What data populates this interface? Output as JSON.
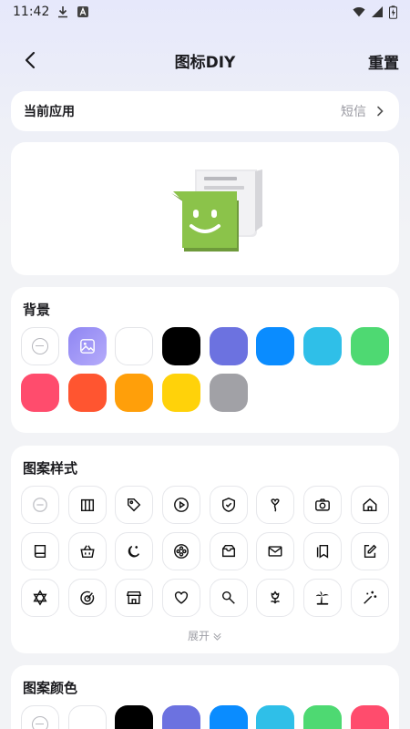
{
  "status_bar": {
    "time": "11:42"
  },
  "header": {
    "title": "图标DIY",
    "reset_label": "重置"
  },
  "current_app": {
    "label": "当前应用",
    "value": "短信"
  },
  "background": {
    "title": "背景",
    "colors": [
      "#ffffff",
      "#000000",
      "#6c72e0",
      "#0a8cff",
      "#2fbfe8",
      "#4ed972",
      "#ff4c6d",
      "#ff5530",
      "#ff9f0a",
      "#ffd20a",
      "#a1a1a6"
    ],
    "image_gradient": [
      "#8f86f3",
      "#b5abfa"
    ]
  },
  "pattern_style": {
    "title": "图案样式",
    "icons": [
      "none-icon",
      "books-icon",
      "tag-icon",
      "play-circle-icon",
      "shield-check-icon",
      "balloon-icon",
      "camera-icon",
      "home-icon",
      "book-icon",
      "basket-icon",
      "moon-stars-icon",
      "film-reel-icon",
      "tray-icon",
      "mail-icon",
      "bookmarks-icon",
      "edit-icon",
      "star-of-david-icon",
      "target-icon",
      "store-icon",
      "heart-icon",
      "magnifier-icon",
      "flower-icon",
      "palm-island-icon",
      "magic-wand-icon"
    ],
    "expand_label": "展开"
  },
  "pattern_color": {
    "title": "图案颜色",
    "colors": [
      "#ffffff",
      "#000000",
      "#6c72e0",
      "#0a8cff",
      "#2fbfe8",
      "#4ed972",
      "#ff4c6d"
    ]
  },
  "colors": {
    "icon_green": "#8bc34a"
  }
}
